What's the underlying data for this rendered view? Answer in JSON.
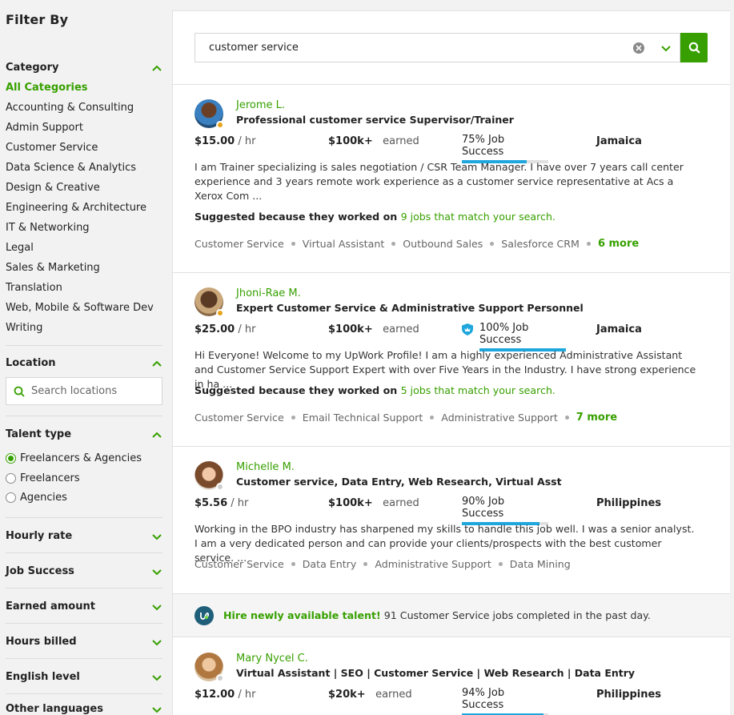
{
  "sidebar": {
    "title": "Filter By",
    "category": {
      "label": "Category",
      "items": [
        "All Categories",
        "Accounting & Consulting",
        "Admin Support",
        "Customer Service",
        "Data Science & Analytics",
        "Design & Creative",
        "Engineering & Architecture",
        "IT & Networking",
        "Legal",
        "Sales & Marketing",
        "Translation",
        "Web, Mobile & Software Dev",
        "Writing"
      ]
    },
    "location": {
      "label": "Location",
      "placeholder": "Search locations"
    },
    "talent_type": {
      "label": "Talent type",
      "options": [
        "Freelancers & Agencies",
        "Freelancers",
        "Agencies"
      ],
      "selected": "Freelancers & Agencies"
    },
    "collapsed_sections": [
      "Hourly rate",
      "Job Success",
      "Earned amount",
      "Hours billed",
      "English level",
      "Other languages"
    ]
  },
  "search": {
    "value": "customer service"
  },
  "colors": {
    "accent": "#37a000",
    "job_success_bar": "#1fa7dd"
  },
  "freelancers": [
    {
      "name": "Jerome L.",
      "title": "Professional customer service Supervisor/Trainer",
      "rate": "$15.00",
      "rate_unit": "/ hr",
      "earned": "$100k+",
      "earned_label": "earned",
      "job_success": "75% Job Success",
      "job_success_pct": 75,
      "country": "Jamaica",
      "description": "I am Trainer specializing is sales negotiation / CSR Team Manager. I have over 7 years call center experience and 3 years remote work experience as a customer service representative at Acs a Xerox Com ...",
      "suggest_prefix": "Suggested because they worked on",
      "suggest_link": "9 jobs that match your search.",
      "skills": [
        "Customer Service",
        "Virtual Assistant",
        "Outbound Sales",
        "Salesforce CRM"
      ],
      "more": "6 more",
      "status_color": "#e8a317"
    },
    {
      "name": "Jhoni-Rae M.",
      "title": "Expert Customer Service & Administrative Support Personnel",
      "rate": "$25.00",
      "rate_unit": "/ hr",
      "earned": "$100k+",
      "earned_label": "earned",
      "job_success": "100% Job Success",
      "job_success_pct": 100,
      "country": "Jamaica",
      "description": "Hi Everyone! Welcome to my UpWork Profile! I am a highly experienced Administrative Assistant and Customer Service Support Expert with over Five Years in the Industry. I have strong experience in ha ...",
      "suggest_prefix": "Suggested because they worked on",
      "suggest_link": "5 jobs that match your search.",
      "skills": [
        "Customer Service",
        "Email Technical Support",
        "Administrative Support"
      ],
      "more": "7 more",
      "status_color": "#e8a317"
    },
    {
      "name": "Michelle M.",
      "title": "Customer service, Data Entry, Web Research, Virtual Asst",
      "rate": "$5.56",
      "rate_unit": "/ hr",
      "earned": "$100k+",
      "earned_label": "earned",
      "job_success": "90% Job Success",
      "job_success_pct": 90,
      "country": "Philippines",
      "description": "Working in the BPO industry has sharpened my skills to handle this job well. I was a senior analyst. I am a very dedicated person and can provide your clients/prospects with the best customer service. ...",
      "skills": [
        "Customer Service",
        "Data Entry",
        "Administrative Support",
        "Data Mining"
      ],
      "status_color": "#cfcfcf"
    },
    {
      "name": "Mary Nycel C.",
      "title": "Virtual Assistant | SEO | Customer Service | Web Research | Data Entry",
      "rate": "$12.00",
      "rate_unit": "/ hr",
      "earned": "$20k+",
      "earned_label": "earned",
      "job_success": "94% Job Success",
      "job_success_pct": 94,
      "country": "Philippines",
      "status_color": "#cfcfcf"
    }
  ],
  "banner": {
    "highlight": "Hire newly available talent!",
    "text": "91 Customer Service jobs completed in the past day."
  }
}
